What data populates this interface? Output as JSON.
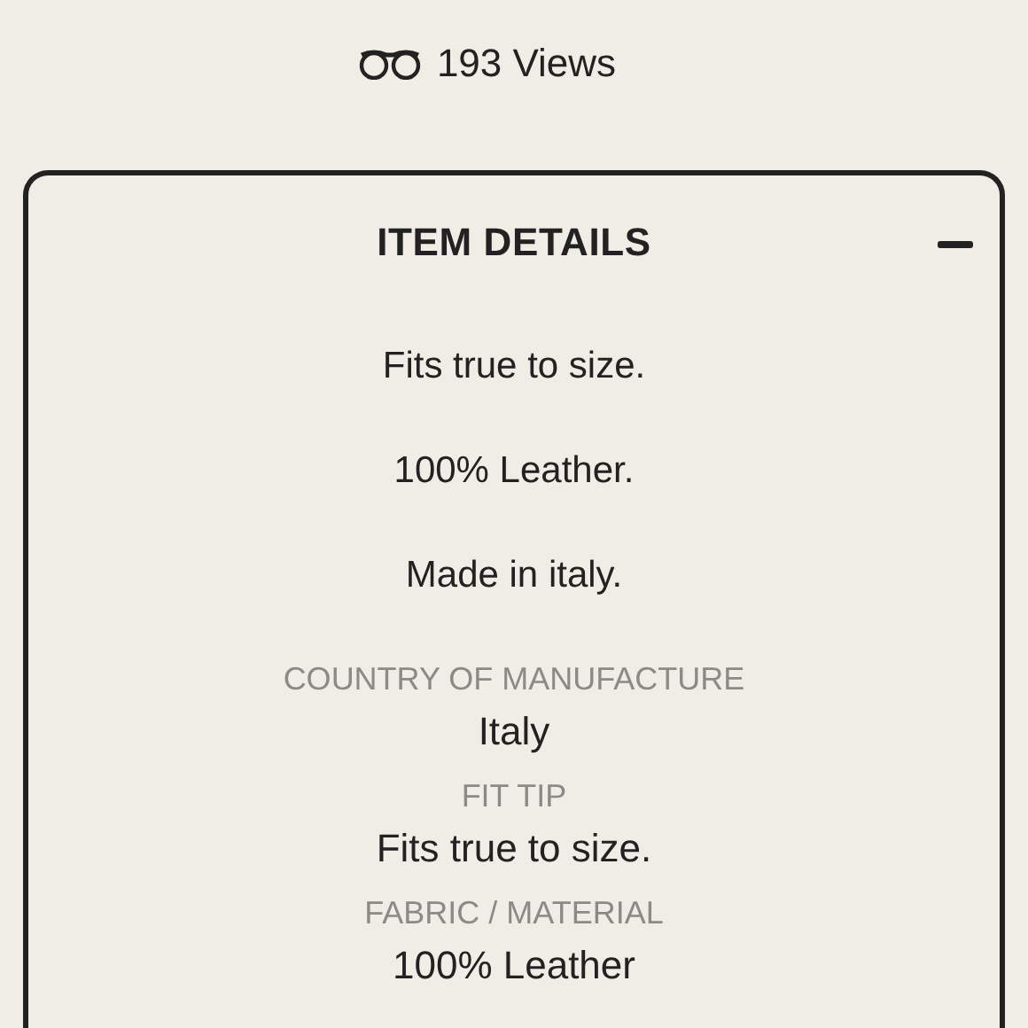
{
  "views": "193 Views",
  "details": {
    "title": "ITEM DETAILS",
    "expanded": true,
    "description": [
      "Fits true to size.",
      "100% Leather.",
      "Made in italy."
    ],
    "attributes": [
      {
        "label": "COUNTRY OF MANUFACTURE",
        "value": "Italy"
      },
      {
        "label": "FIT TIP",
        "value": "Fits true to size."
      },
      {
        "label": "FABRIC / MATERIAL",
        "value": "100% Leather"
      }
    ]
  }
}
